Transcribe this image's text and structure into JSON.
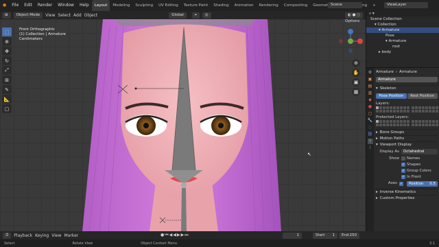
{
  "topbar": {
    "menus": [
      "File",
      "Edit",
      "Render",
      "Window",
      "Help"
    ],
    "tabs": [
      "Layout",
      "Modeling",
      "Sculpting",
      "UV Editing",
      "Texture Paint",
      "Shading",
      "Animation",
      "Rendering",
      "Compositing",
      "Geometry Nodes",
      "Scripting"
    ],
    "active_tab": "Layout",
    "scene": "Scene",
    "view_layer": "ViewLayer"
  },
  "viewport_header": {
    "mode": "Object Mode",
    "menus": [
      "View",
      "Select",
      "Add",
      "Object"
    ],
    "transform": "Global",
    "options": "Options"
  },
  "viewport_info": {
    "line1": "Front Orthographic",
    "line2": "(1) Collection | Armature",
    "line3": "Centimeters"
  },
  "outliner": {
    "rows": [
      {
        "label": "Scene Collection",
        "indent": 0
      },
      {
        "label": "Collection",
        "indent": 1
      },
      {
        "label": "Armature",
        "indent": 2,
        "selected": true
      },
      {
        "label": "Pose",
        "indent": 3
      },
      {
        "label": "Armature",
        "indent": 3
      },
      {
        "label": "root",
        "indent": 4
      },
      {
        "label": "body",
        "indent": 2
      }
    ]
  },
  "properties": {
    "breadcrumb": [
      "Armature",
      "Armature"
    ],
    "name": "Armature",
    "skeleton_label": "Skeleton",
    "pose_position": "Pose Position",
    "rest_position": "Rest Position",
    "layers_label": "Layers:",
    "protected_layers_label": "Protected Layers:",
    "panels": [
      "Bone Groups",
      "Motion Paths"
    ],
    "viewport_display": {
      "label": "Viewport Display",
      "display_as_label": "Display As",
      "display_as": "Octahedral",
      "show_label": "Show",
      "options": [
        "Names",
        "Shapes",
        "Group Colors",
        "In Front"
      ],
      "axes_label": "Axes",
      "axes_position_label": "Position",
      "axes_position_value": "0.5"
    },
    "more_panels": [
      "Inverse Kinematics",
      "Custom Properties"
    ]
  },
  "timeline": {
    "menus": [
      "Playback",
      "Keying",
      "View",
      "Marker"
    ],
    "current_frame": "1",
    "start_label": "Start",
    "start": "1",
    "end_label": "End",
    "end": "250"
  },
  "statusbar": {
    "left": "Select",
    "mid": "Rotate View",
    "right": "Object Context Menu",
    "version": "3.1"
  }
}
